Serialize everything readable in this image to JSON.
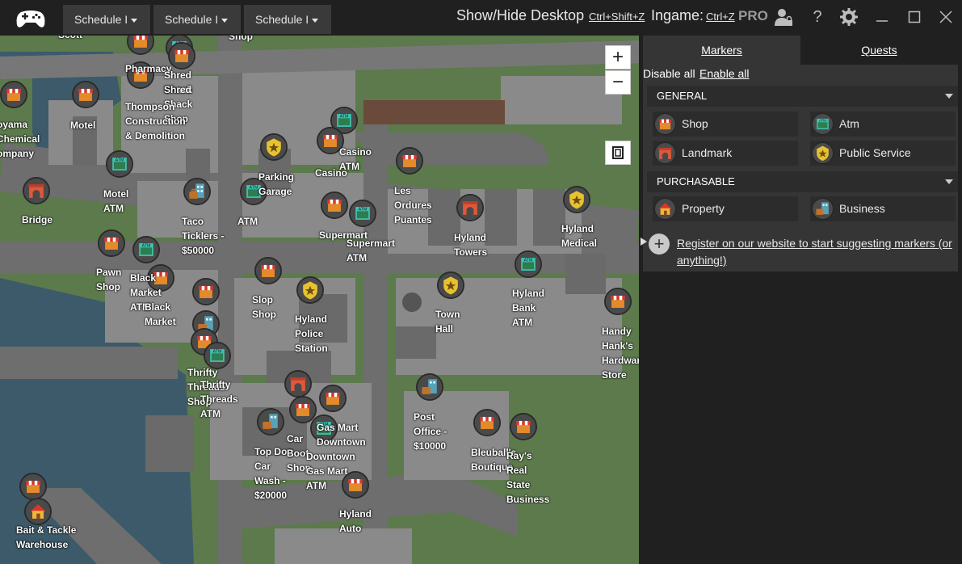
{
  "titlebar": {
    "tabs": [
      {
        "label": "Schedule I"
      },
      {
        "label": "Schedule I"
      },
      {
        "label": "Schedule I"
      }
    ],
    "show_hide_label": "Show/Hide Desktop",
    "show_hide_key": "Ctrl+Shift+Z",
    "ingame_label": "Ingame:",
    "ingame_key": "Ctrl+Z",
    "pro_label": "PRO",
    "icons": [
      "gamepad-icon",
      "user-lock-icon",
      "help-icon",
      "gear-icon",
      "minimize-icon",
      "maximize-icon",
      "close-icon"
    ]
  },
  "map": {
    "zoom_in": "+",
    "zoom_out": "−",
    "labels": [
      "Scott",
      "Pharmacy",
      "Shop",
      "Shred Shack",
      "Shred Shack Shop",
      "Thompson Construction & Demolition",
      "Motel",
      "oyama Chemical ompany",
      "Casino",
      "Casino ATM",
      "Motel ATM",
      "Parking Garage",
      "Bridge",
      "Taco Ticklers - $50000",
      "ATM",
      "Les Ordures Puantes",
      "Hyland Towers",
      "Hyland Medical",
      "Supermart",
      "Supermart ATM",
      "Pawn Shop",
      "Black Market ATM",
      "Black Market",
      "Slop Shop",
      "Hyland Police Station",
      "Town Hall",
      "Hyland Bank ATM",
      "Handy Hank's Hardware Store",
      "Thrifty Threads Shop",
      "Thrifty Threads ATM",
      "Top Dog Car Wash - $20000",
      "Car Boot Shop",
      "Gas Mart Downtown",
      "Downtown Gas Mart ATM",
      "Post Office - $10000",
      "Bleuball's Boutique",
      "Ray's Real State Business",
      "Hyland Auto",
      "Bait & Tackle Warehouse"
    ]
  },
  "panel": {
    "tab_markers": "Markers",
    "tab_quests": "Quests",
    "disable_all": "Disable all",
    "enable_all": "Enable all",
    "section_general": "GENERAL",
    "section_purchasable": "PURCHASABLE",
    "general_items": [
      {
        "label": "Shop",
        "icon": "shop-icon"
      },
      {
        "label": "Atm",
        "icon": "atm-icon"
      },
      {
        "label": "Landmark",
        "icon": "landmark-icon"
      },
      {
        "label": "Public Service",
        "icon": "badge-icon"
      }
    ],
    "purchasable_items": [
      {
        "label": "Property",
        "icon": "house-icon"
      },
      {
        "label": "Business",
        "icon": "business-icon"
      }
    ],
    "register_text": "Register on our website to start suggesting markers (or anything!)"
  },
  "colors": {
    "titlebar_bg": "#202020",
    "tab_bg": "#3a3a3a",
    "panel_bg": "#353535",
    "map_grass": "#5c7a4c",
    "map_road": "#6e6e6e",
    "map_water": "#3c5a6a"
  }
}
